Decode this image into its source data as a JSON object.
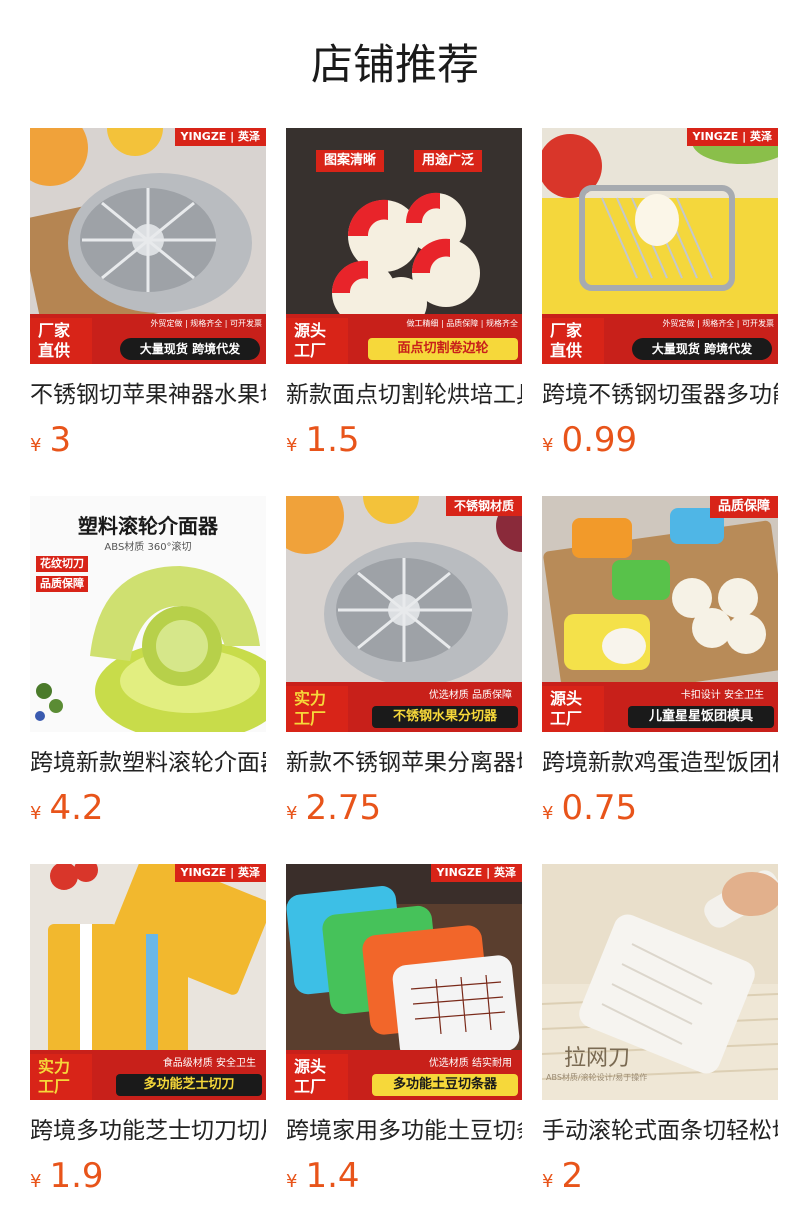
{
  "header": {
    "title": "店铺推荐"
  },
  "colors": {
    "accent": "#e8541a",
    "badge_red": "#d82418"
  },
  "products": [
    {
      "title": "不锈钢切苹果神器水果切片器",
      "currency": "¥",
      "price": "3",
      "image": {
        "brand": "YINGZE | 英泽",
        "tag_left": "厂家\n直供",
        "tag_left_l1": "厂家",
        "tag_left_l2": "直供",
        "strip": "外贸定做 | 规格齐全 | 可开发票",
        "banner": "大量现货 跨境代发"
      }
    },
    {
      "title": "新款面点切割轮烘培工具",
      "currency": "¥",
      "price": "1.5",
      "image": {
        "chip1": "图案清晰",
        "chip2": "用途广泛",
        "tag_left_l1": "源头",
        "tag_left_l2": "工厂",
        "strip": "做工精细 | 品质保障 | 规格齐全",
        "banner": "面点切割卷边轮"
      }
    },
    {
      "title": "跨境不锈钢切蛋器多功能",
      "currency": "¥",
      "price": "0.99",
      "image": {
        "brand": "YINGZE | 英泽",
        "tag_left_l1": "厂家",
        "tag_left_l2": "直供",
        "strip": "外贸定做 | 规格齐全 | 可开发票",
        "banner": "大量现货 跨境代发"
      }
    },
    {
      "title": "跨境新款塑料滚轮介面器",
      "currency": "¥",
      "price": "4.2",
      "image": {
        "headline": "塑料滚轮介面器",
        "sub": "ABS材质 360°滚切",
        "chip1": "花纹切刀",
        "chip2": "品质保障"
      }
    },
    {
      "title": "新款不锈钢苹果分离器切片",
      "currency": "¥",
      "price": "2.75",
      "image": {
        "corner": "不锈钢材质",
        "tag_left_l1": "实力",
        "tag_left_l2": "工厂",
        "strip": "优选材质  品质保障",
        "banner": "不锈钢水果分切器"
      }
    },
    {
      "title": "跨境新款鸡蛋造型饭团模具",
      "currency": "¥",
      "price": "0.75",
      "image": {
        "corner": "品质保障",
        "tag_left_l1": "源头",
        "tag_left_l2": "工厂",
        "strip": "卡扣设计  安全卫生",
        "banner": "儿童星星饭团模具"
      }
    },
    {
      "title": "跨境多功能芝士切刀切片器",
      "currency": "¥",
      "price": "1.9",
      "image": {
        "brand": "YINGZE | 英泽",
        "tag_left_l1": "实力",
        "tag_left_l2": "工厂",
        "strip": "食品级材质  安全卫生",
        "banner": "多功能芝士切刀"
      }
    },
    {
      "title": "跨境家用多功能土豆切条器",
      "currency": "¥",
      "price": "1.4",
      "image": {
        "brand": "YINGZE | 英泽",
        "tag_left_l1": "源头",
        "tag_left_l2": "工厂",
        "strip": "优选材质  结实耐用",
        "banner": "多功能土豆切条器"
      }
    },
    {
      "title": "手动滚轮式面条切轻松切面",
      "currency": "¥",
      "price": "2",
      "image": {
        "label": "拉网刀",
        "sub": "ABS材质/滚轮设计/易于操作"
      }
    }
  ]
}
